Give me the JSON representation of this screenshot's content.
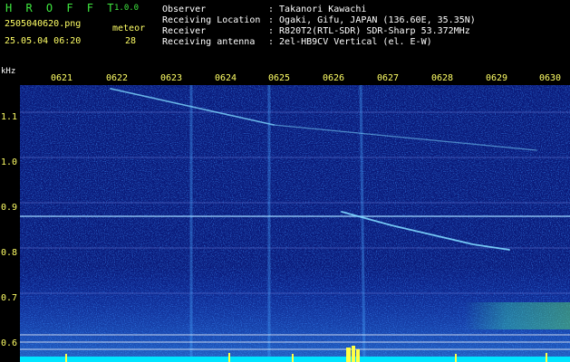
{
  "header": {
    "app_title": "H R O F F T",
    "version": "1.0.0",
    "file_name": "2505040620.png",
    "date_time": "25.05.04 06:20",
    "meteor_label": "meteor",
    "meteor_count": "28"
  },
  "info": [
    {
      "label": "Observer",
      "value": ": Takanori Kawachi"
    },
    {
      "label": "Receiving Location",
      "value": ": Ogaki, Gifu, JAPAN (136.60E, 35.35N)"
    },
    {
      "label": "Receiver",
      "value": ": R820T2(RTL-SDR) SDR-Sharp 53.372MHz"
    },
    {
      "label": "Receiving antenna",
      "value": ": 2el-HB9CV Vertical (el. E-W)"
    }
  ],
  "time_axis": [
    "0621",
    "0622",
    "0623",
    "0624",
    "0625",
    "0626",
    "0627",
    "0628",
    "0629",
    "0630"
  ],
  "freq_axis": {
    "unit": "kHz",
    "labels": [
      "1.1",
      "1.0",
      "0.9",
      "0.8",
      "0.7",
      "0.6"
    ]
  },
  "colors": {
    "background": "#000000",
    "plot_background": "#0a1a7a",
    "text_yellow": "#ffff66",
    "text_green": "#3fe83f",
    "text_white": "#ffffff"
  }
}
